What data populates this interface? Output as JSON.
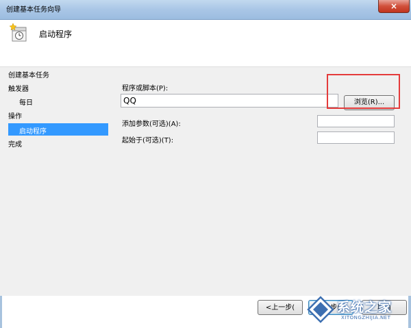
{
  "window": {
    "title": "创建基本任务向导",
    "close_symbol": "×"
  },
  "header": {
    "title": "启动程序"
  },
  "steps": {
    "create_basic_task": "创建基本任务",
    "trigger": "触发器",
    "daily": "每日",
    "action": "操作",
    "start_program": "启动程序",
    "finish": "完成"
  },
  "form": {
    "program_label": "程序或脚本(P):",
    "program_value": "QQ",
    "browse_label": "浏览(R)...",
    "args_label": "添加参数(可选)(A):",
    "args_value": "",
    "start_in_label": "起始于(可选)(T):",
    "start_in_value": ""
  },
  "footer": {
    "back_label": "<上一步(",
    "next_label": "下一步(N",
    "cancel_label": "取消"
  },
  "watermark": {
    "text": "系统之家",
    "sub": "XITONGZHIJIA.NET"
  },
  "colors": {
    "selection": "#3399ff",
    "highlight_box": "#e43a3a"
  }
}
